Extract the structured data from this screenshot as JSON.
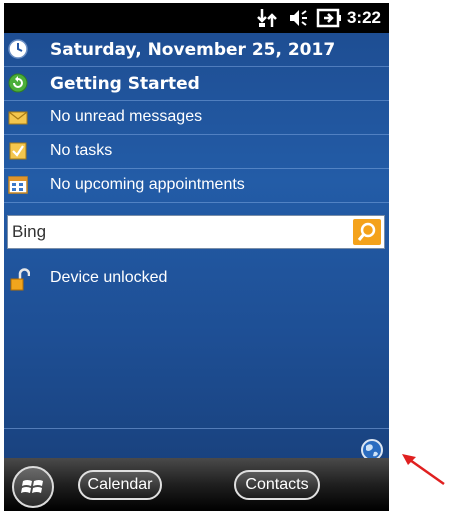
{
  "status_bar": {
    "icons": [
      "network-sync-icon",
      "speaker-icon",
      "battery-plug-icon"
    ],
    "time": "3:22"
  },
  "today": {
    "date": "Saturday, November 25, 2017",
    "getting_started": "Getting Started",
    "messages": "No unread messages",
    "tasks": "No tasks",
    "appointments": "No upcoming appointments"
  },
  "search": {
    "placeholder": "Bing"
  },
  "device_status": "Device unlocked",
  "softkeys": {
    "left": "Calendar",
    "right": "Contacts"
  },
  "colors": {
    "accent_search": "#f4a21b",
    "background": "#1e4f95",
    "annotation_arrow": "#e02020"
  }
}
